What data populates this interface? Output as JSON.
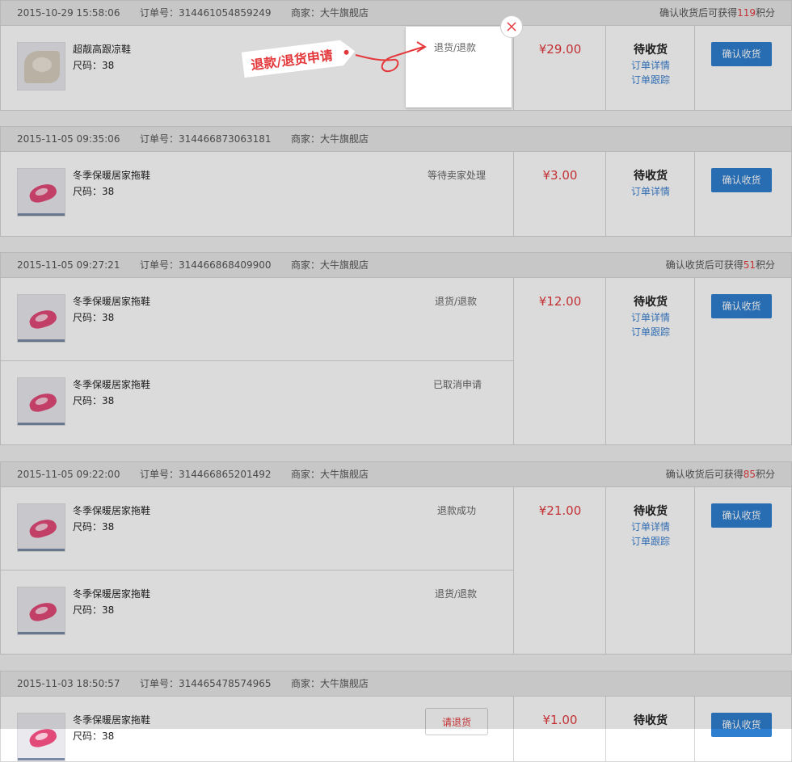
{
  "orders": [
    {
      "date": "2015-10-29 15:58:06",
      "order_no": "订单号：314461054859249",
      "shop": "商家：大牛旗舰店",
      "points_pre": "确认收货后可获得",
      "points": "119",
      "points_post": "积分",
      "price": "¥29.00",
      "status": "待收货",
      "links": [
        "订单详情",
        "订单跟踪"
      ],
      "action": "确认收货",
      "items": [
        {
          "name": "超靓高跟凉鞋",
          "size": "尺码：38",
          "status": "",
          "thumb": "sandal"
        }
      ]
    },
    {
      "date": "2015-11-05 09:35:06",
      "order_no": "订单号：314466873063181",
      "shop": "商家：大牛旗舰店",
      "points_pre": "",
      "points": "",
      "points_post": "",
      "price": "¥3.00",
      "status": "待收货",
      "links": [
        "订单详情"
      ],
      "action": "确认收货",
      "items": [
        {
          "name": "冬季保暖居家拖鞋",
          "size": "尺码：38",
          "status": "等待卖家处理",
          "thumb": "slipper"
        }
      ]
    },
    {
      "date": "2015-11-05 09:27:21",
      "order_no": "订单号：314466868409900",
      "shop": "商家：大牛旗舰店",
      "points_pre": "确认收货后可获得",
      "points": "51",
      "points_post": "积分",
      "price": "¥12.00",
      "status": "待收货",
      "links": [
        "订单详情",
        "订单跟踪"
      ],
      "action": "确认收货",
      "items": [
        {
          "name": "冬季保暖居家拖鞋",
          "size": "尺码：38",
          "status": "退货/退款",
          "thumb": "slipper"
        },
        {
          "name": "冬季保暖居家拖鞋",
          "size": "尺码：38",
          "status": "已取消申请",
          "thumb": "slipper"
        }
      ]
    },
    {
      "date": "2015-11-05 09:22:00",
      "order_no": "订单号：314466865201492",
      "shop": "商家：大牛旗舰店",
      "points_pre": "确认收货后可获得",
      "points": "85",
      "points_post": "积分",
      "price": "¥21.00",
      "status": "待收货",
      "links": [
        "订单详情",
        "订单跟踪"
      ],
      "action": "确认收货",
      "items": [
        {
          "name": "冬季保暖居家拖鞋",
          "size": "尺码：38",
          "status": "退款成功",
          "thumb": "slipper"
        },
        {
          "name": "冬季保暖居家拖鞋",
          "size": "尺码：38",
          "status": "退货/退款",
          "thumb": "slipper"
        }
      ]
    },
    {
      "date": "2015-11-03 18:50:57",
      "order_no": "订单号：314465478574965",
      "shop": "商家：大牛旗舰店",
      "points_pre": "",
      "points": "",
      "points_post": "",
      "price": "¥1.00",
      "status": "待收货",
      "links": [],
      "action": "确认收货",
      "items": [
        {
          "name": "冬季保暖居家拖鞋",
          "size": "尺码：38",
          "status": "",
          "thumb": "slipper",
          "return_button": "请退货"
        }
      ]
    }
  ],
  "popup": {
    "option": "退货/退款",
    "close_icon": "close-icon"
  },
  "callout": {
    "label": "退款/退货申请"
  },
  "colors": {
    "accent": "#e4393c",
    "button": "#2f7fd0",
    "link": "#3a7fd0"
  }
}
